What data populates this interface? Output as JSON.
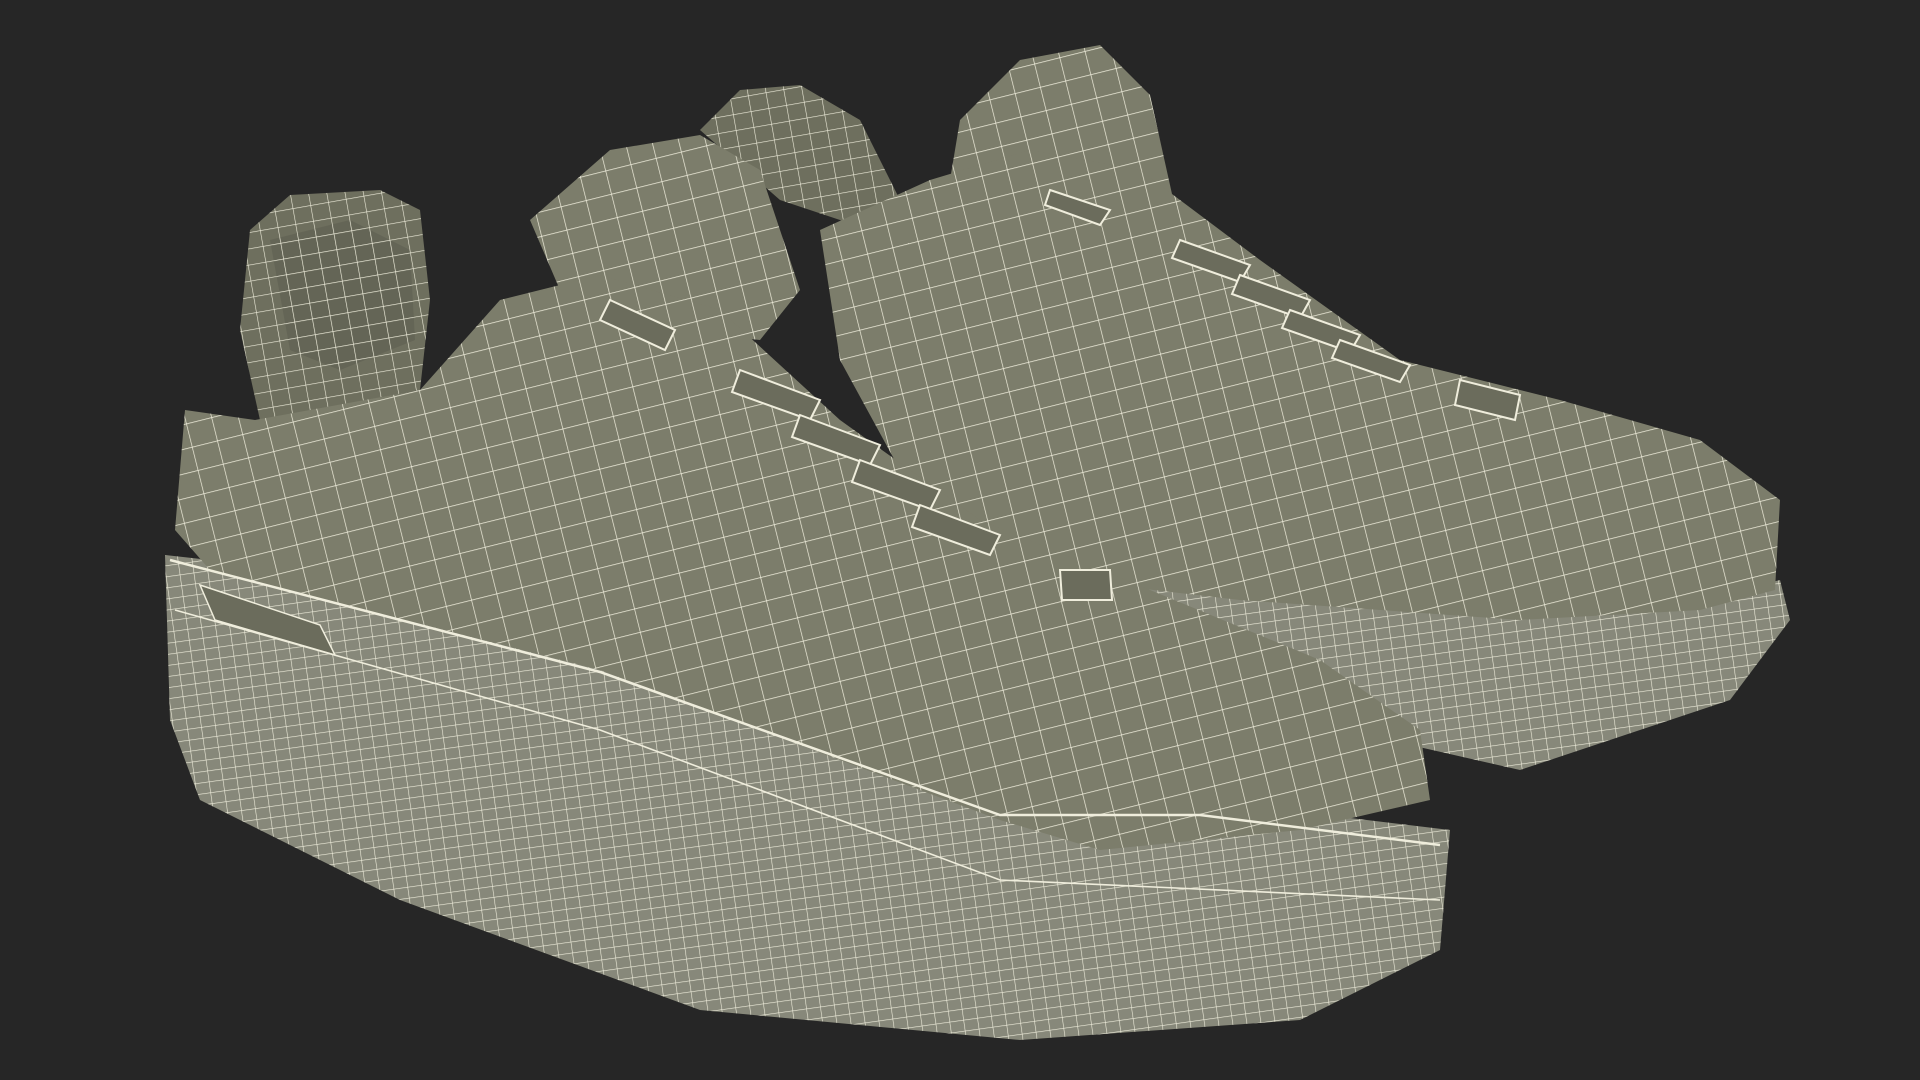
{
  "scene": {
    "subject": "pair-of-low-top-sneakers",
    "render_style": "wireframe",
    "colors": {
      "background": "#262626",
      "shoe_surface": "#7c7d6b",
      "shoe_shadow": "#5f6152",
      "sole": "#87887a",
      "wire": "#efeddc"
    }
  }
}
